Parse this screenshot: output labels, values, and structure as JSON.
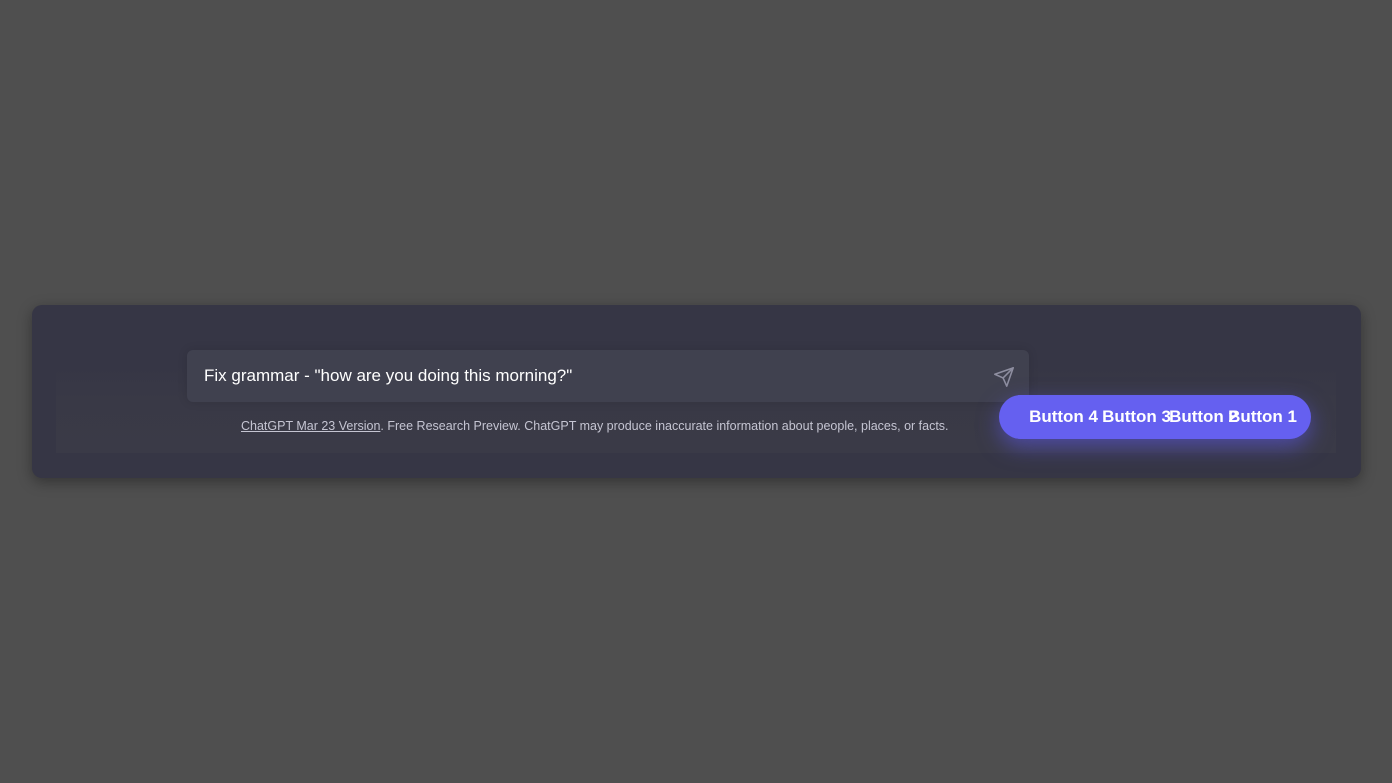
{
  "prompt": {
    "value": "Fix grammar - \"how are you doing this morning?\""
  },
  "send": {
    "icon": "paper-plane-icon"
  },
  "footer": {
    "link_text": "ChatGPT Mar 23 Version",
    "text": ". Free Research Preview. ChatGPT may produce inaccurate information about people, places, or facts."
  },
  "buttons": [
    {
      "label": "Button 4"
    },
    {
      "label": "Button 3"
    },
    {
      "label": "Button 2"
    },
    {
      "label": "Button 1"
    }
  ],
  "colors": {
    "background": "#4f4f4f",
    "panel": "#363645",
    "input": "#40414f",
    "accent": "#6560f0"
  }
}
